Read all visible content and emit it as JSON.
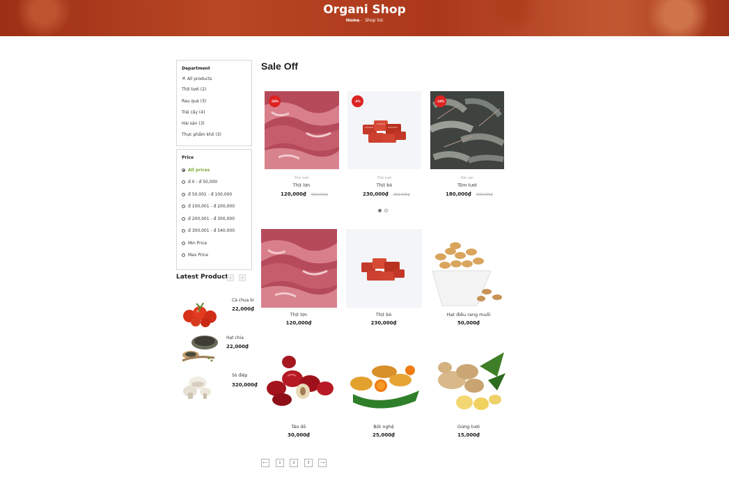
{
  "header": {
    "title": "Organi Shop",
    "breadcrumb_home": "Home",
    "breadcrumb_sep": "-",
    "breadcrumb_current": "Shop list"
  },
  "department": {
    "title": "Department",
    "items": [
      "All products",
      "Thịt tươi (2)",
      "Rau quả (3)",
      "Trái cây (4)",
      "Hải sản (3)",
      "Thực phẩm khô (3)"
    ]
  },
  "price": {
    "title": "Price",
    "options": [
      "All prices",
      "đ 0 - đ 50,000",
      "đ 50,001 - đ 100,000",
      "đ 100,001 - đ 200,000",
      "đ 200,001 - đ 300,000",
      "đ 300,001 - đ 540,000",
      "Min Price",
      "Max Price"
    ]
  },
  "latest": {
    "title": "Latest Products",
    "prev": "‹",
    "next": "›",
    "items": [
      {
        "name": "Cà chua bi",
        "price": "22,000₫"
      },
      {
        "name": "Hạt chia",
        "price": "22,000₫"
      },
      {
        "name": "Sò điệp",
        "price": "320,000₫"
      }
    ]
  },
  "sale": {
    "title": "Sale Off",
    "items": [
      {
        "badge": "-20%",
        "category": "Thịt tươi",
        "name": "Thịt lợn",
        "price": "120,000₫",
        "old_price": "150,000₫"
      },
      {
        "badge": "-8%",
        "category": "Thịt tươi",
        "name": "Thịt bò",
        "price": "230,000₫",
        "old_price": "250,000₫"
      },
      {
        "badge": "-10%",
        "category": "Hải sản",
        "name": "Tôm tươi",
        "price": "180,000₫",
        "old_price": "200,000₫"
      }
    ]
  },
  "products": [
    {
      "name": "Thịt lợn",
      "price": "120,000₫"
    },
    {
      "name": "Thịt bò",
      "price": "230,000₫"
    },
    {
      "name": "Hạt điều rang muối",
      "price": "50,000₫"
    },
    {
      "name": "Táo đỏ",
      "price": "30,000₫"
    },
    {
      "name": "Bột nghệ",
      "price": "25,000₫"
    },
    {
      "name": "Gừng tươi",
      "price": "15,000₫"
    }
  ],
  "pagination": {
    "prev": "⟵",
    "pages": [
      "1",
      "2",
      "3"
    ],
    "next": "⟶"
  },
  "colors": {
    "accent": "#7fad39",
    "badge": "#dd2222"
  }
}
